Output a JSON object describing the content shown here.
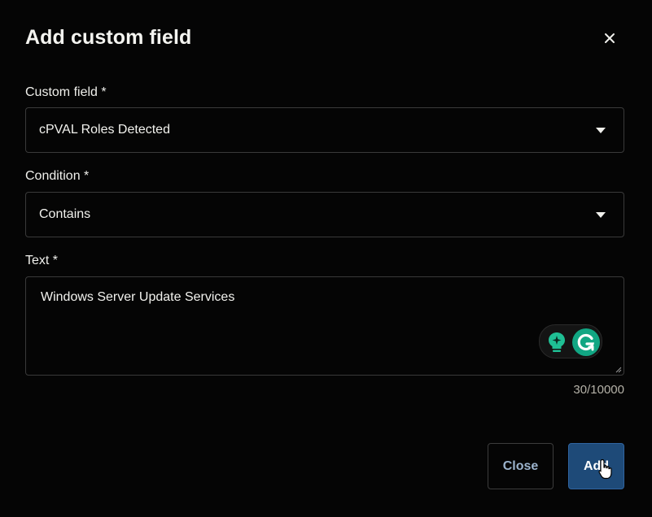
{
  "dialog": {
    "title": "Add custom field",
    "close_icon": "close-icon"
  },
  "custom_field": {
    "label": "Custom field *",
    "value": "cPVAL Roles Detected",
    "icon": "chevron-down-icon"
  },
  "condition": {
    "label": "Condition *",
    "value": "Contains",
    "icon": "chevron-down-icon"
  },
  "text_field": {
    "label": "Text *",
    "value": "Windows Server Update Services",
    "counter": "30/10000"
  },
  "grammarly": {
    "bulb_icon": "lightbulb-sparkle-icon",
    "logo_icon": "grammarly-g-icon",
    "colors": {
      "accent": "#11a683"
    }
  },
  "footer": {
    "close_label": "Close",
    "add_label": "Add"
  },
  "colors": {
    "background": "#050505",
    "border": "#3a3a3a",
    "primary_button": "#1e4a78",
    "secondary_text": "#9bb3cc"
  }
}
